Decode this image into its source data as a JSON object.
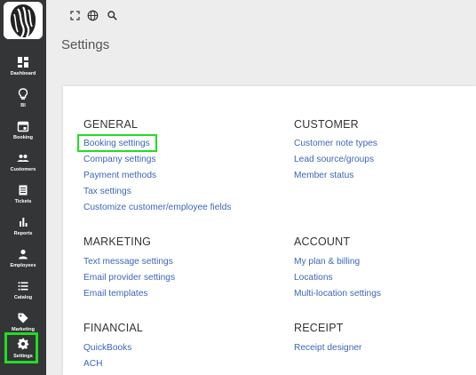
{
  "sidebar": {
    "items": [
      {
        "label": "Dashboard",
        "icon": "dashboard-icon"
      },
      {
        "label": "BI",
        "icon": "lightbulb-icon"
      },
      {
        "label": "Booking",
        "icon": "calendar-icon"
      },
      {
        "label": "Customers",
        "icon": "people-icon"
      },
      {
        "label": "Tickets",
        "icon": "ticket-icon"
      },
      {
        "label": "Reports",
        "icon": "bar-chart-icon"
      },
      {
        "label": "Employees",
        "icon": "person-icon"
      },
      {
        "label": "Catalog",
        "icon": "list-icon"
      },
      {
        "label": "Marketing",
        "icon": "tag-icon"
      },
      {
        "label": "Settings",
        "icon": "gear-icon",
        "active": true
      }
    ]
  },
  "topbar": {
    "icons": [
      "fullscreen-icon",
      "globe-icon",
      "search-icon"
    ]
  },
  "page": {
    "title": "Settings"
  },
  "sections": {
    "general": {
      "heading": "GENERAL",
      "links": [
        "Booking settings",
        "Company settings",
        "Payment methods",
        "Tax settings",
        "Customize customer/employee fields"
      ]
    },
    "customer": {
      "heading": "CUSTOMER",
      "links": [
        "Customer note types",
        "Lead source/groups",
        "Member status"
      ]
    },
    "marketing": {
      "heading": "MARKETING",
      "links": [
        "Text message settings",
        "Email provider settings",
        "Email templates"
      ]
    },
    "account": {
      "heading": "ACCOUNT",
      "links": [
        "My plan & billing",
        "Locations",
        "Multi-location settings"
      ]
    },
    "financial": {
      "heading": "FINANCIAL",
      "links": [
        "QuickBooks",
        "ACH"
      ]
    },
    "receipt": {
      "heading": "RECEIPT",
      "links": [
        "Receipt designer"
      ]
    }
  },
  "colors": {
    "sidebar_bg": "#333537",
    "link": "#3c67b8",
    "highlight": "#22dd22"
  }
}
